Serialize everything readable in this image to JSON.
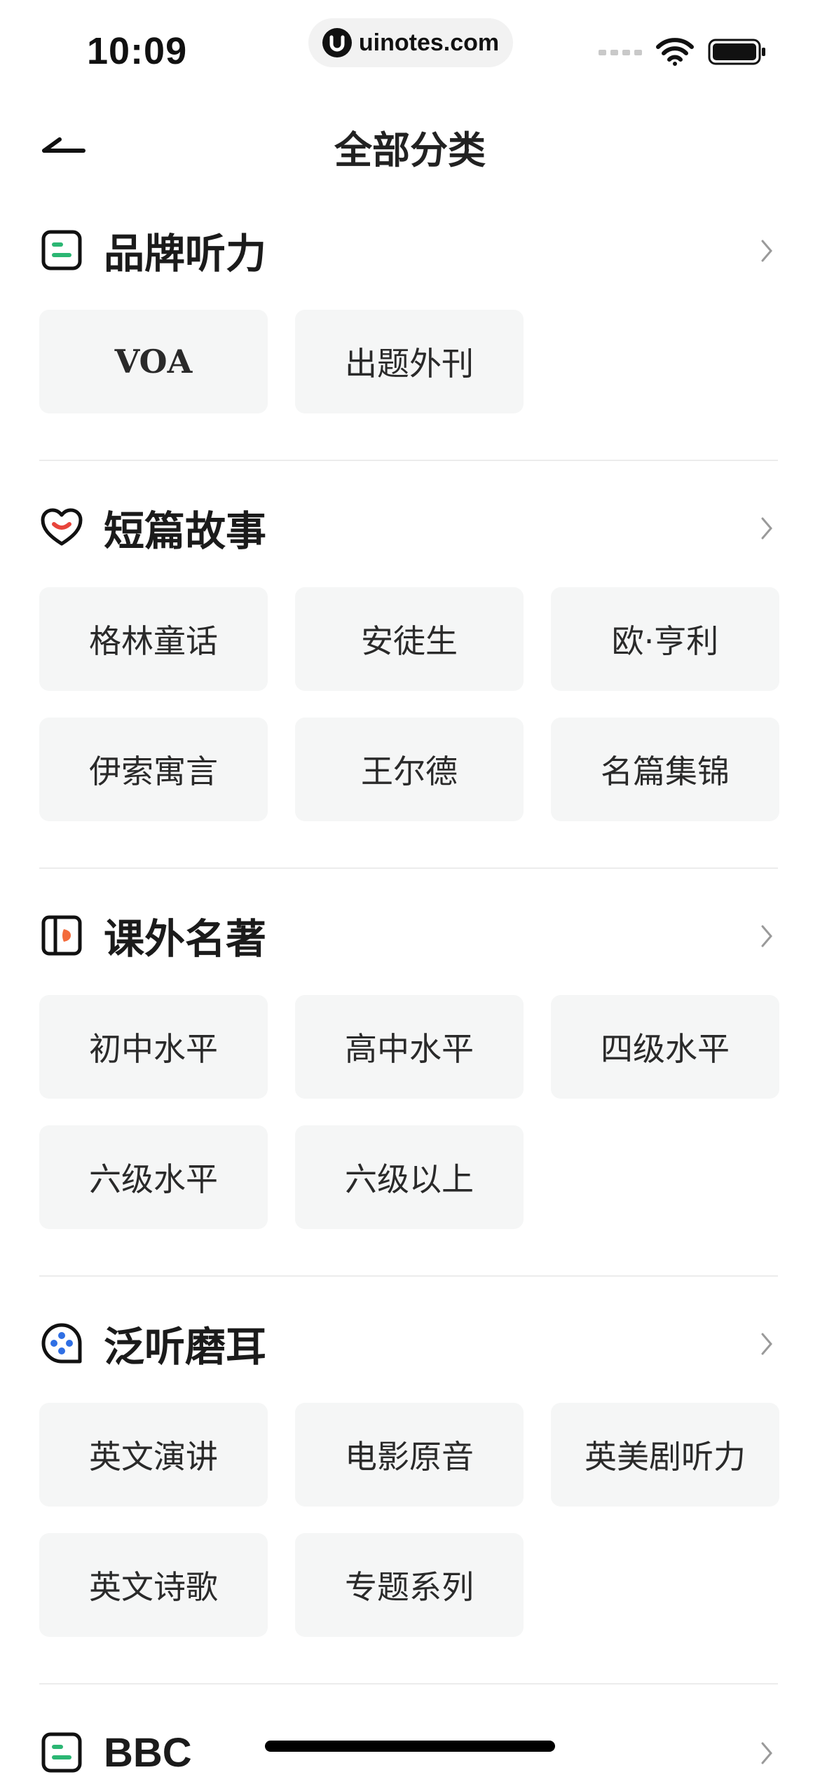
{
  "status_bar": {
    "time": "10:09",
    "watermark": "uinotes.com"
  },
  "header": {
    "title": "全部分类"
  },
  "sections": [
    {
      "title": "品牌听力",
      "icon": "document-icon",
      "items": [
        "VOA",
        "出题外刊"
      ]
    },
    {
      "title": "短篇故事",
      "icon": "heart-icon",
      "items": [
        "格林童话",
        "安徒生",
        "欧·亨利",
        "伊索寓言",
        "王尔德",
        "名篇集锦"
      ]
    },
    {
      "title": "课外名著",
      "icon": "book-icon",
      "items": [
        "初中水平",
        "高中水平",
        "四级水平",
        "六级水平",
        "六级以上"
      ]
    },
    {
      "title": "泛听磨耳",
      "icon": "headphone-icon",
      "items": [
        "英文演讲",
        "电影原音",
        "英美剧听力",
        "英文诗歌",
        "专题系列"
      ]
    },
    {
      "title": "BBC",
      "icon": "document-icon",
      "items": []
    }
  ],
  "colors": {
    "accent_green": "#2bb673",
    "accent_red": "#e8453c",
    "accent_orange": "#f36b3b",
    "accent_blue": "#2f6fe4",
    "chip_bg": "#f5f6f6"
  }
}
